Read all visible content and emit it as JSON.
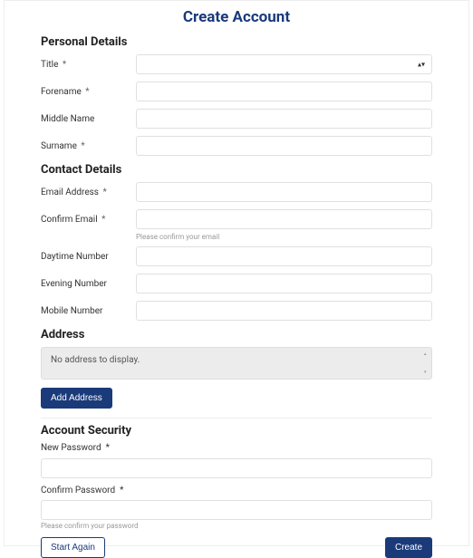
{
  "page": {
    "title": "Create Account"
  },
  "sections": {
    "personal": {
      "heading": "Personal Details",
      "fields": {
        "title": {
          "label": "Title",
          "required_mark": "*"
        },
        "forename": {
          "label": "Forename",
          "required_mark": "*"
        },
        "middle": {
          "label": "Middle Name"
        },
        "surname": {
          "label": "Surname",
          "required_mark": "*"
        }
      }
    },
    "contact": {
      "heading": "Contact Details",
      "fields": {
        "email": {
          "label": "Email Address",
          "required_mark": "*"
        },
        "confirm_email": {
          "label": "Confirm Email",
          "required_mark": "*",
          "help": "Please confirm your email"
        },
        "daytime": {
          "label": "Daytime Number"
        },
        "evening": {
          "label": "Evening Number"
        },
        "mobile": {
          "label": "Mobile Number"
        }
      }
    },
    "address": {
      "heading": "Address",
      "empty_text": "No address to display.",
      "add_button": "Add Address"
    },
    "security": {
      "heading": "Account Security",
      "fields": {
        "new_password": {
          "label": "New Password",
          "required_mark": "*"
        },
        "confirm_password": {
          "label": "Confirm Password",
          "required_mark": "*",
          "help": "Please confirm your password"
        }
      }
    }
  },
  "footer": {
    "start_again": "Start Again",
    "create": "Create"
  }
}
